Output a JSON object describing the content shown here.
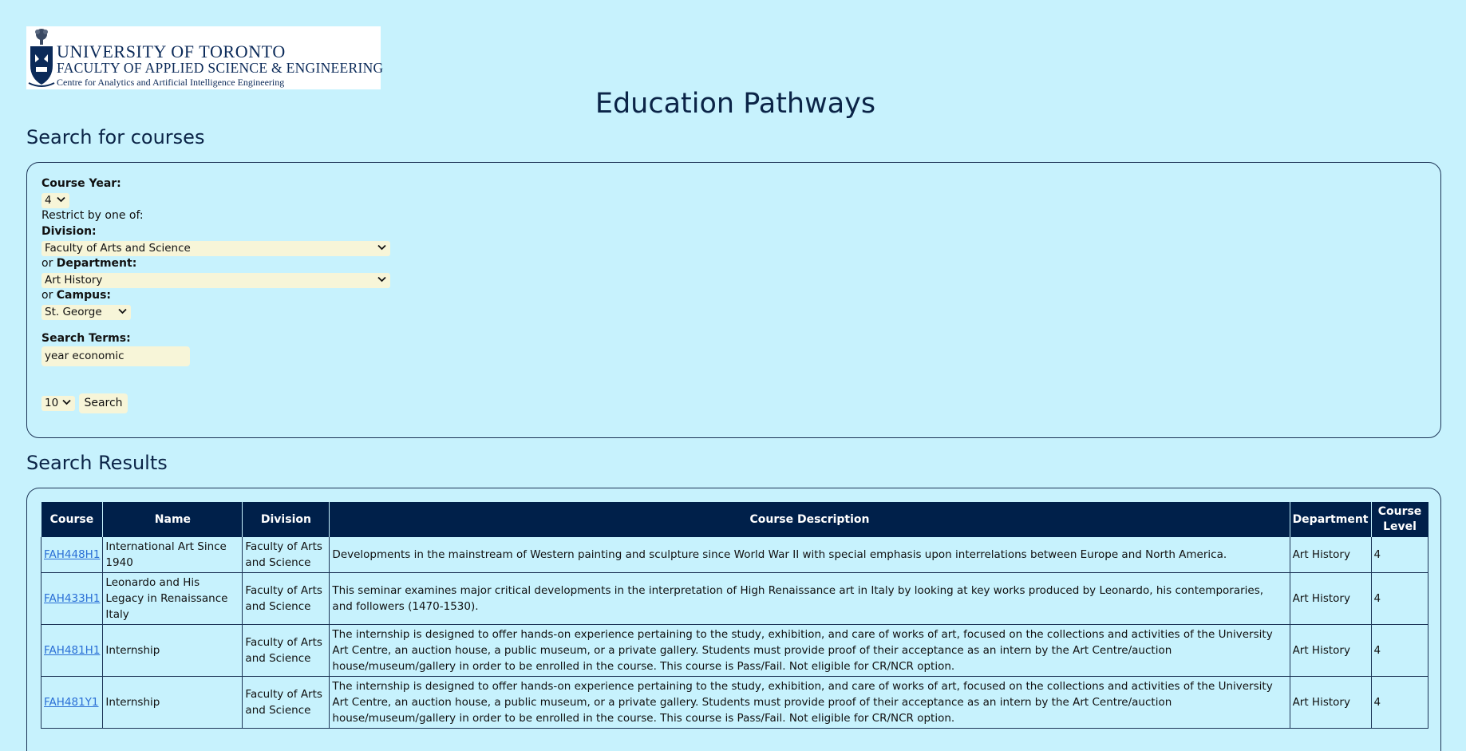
{
  "logo": {
    "line1": "UNIVERSITY OF TORONTO",
    "line2": "FACULTY OF APPLIED SCIENCE & ENGINEERING",
    "line3": "Centre for Analytics and Artificial Intelligence Engineering"
  },
  "app_title": "Education Pathways",
  "search": {
    "heading": "Search for courses",
    "course_year_label": "Course Year:",
    "course_year_value": "4",
    "restrict_text": "Restrict by one of:",
    "division_label": "Division:",
    "division_value": "Faculty of Arts and Science",
    "or_text": "or",
    "department_label": "Department:",
    "department_value": "Art History",
    "campus_label": "Campus:",
    "campus_value": "St. George",
    "terms_label": "Search Terms:",
    "terms_value": "year economic",
    "results_count_value": "10",
    "search_button": "Search"
  },
  "results": {
    "heading": "Search Results",
    "columns": [
      "Course",
      "Name",
      "Division",
      "Course Description",
      "Department",
      "Course Level"
    ],
    "rows": [
      {
        "course": "FAH448H1",
        "name": "International Art Since 1940",
        "division": "Faculty of Arts and Science",
        "description": "Developments in the mainstream of Western painting and sculpture since World War II with special emphasis upon interrelations between Europe and North America.",
        "department": "Art History",
        "level": "4"
      },
      {
        "course": "FAH433H1",
        "name": "Leonardo and His Legacy in Renaissance Italy",
        "division": "Faculty of Arts and Science",
        "description": "This seminar examines major critical developments in the interpretation of High Renaissance art in Italy by looking at key works produced by Leonardo, his contemporaries, and followers (1470-1530).",
        "department": "Art History",
        "level": "4"
      },
      {
        "course": "FAH481H1",
        "name": "Internship",
        "division": "Faculty of Arts and Science",
        "description": "The internship is designed to offer hands-on experience pertaining to the study, exhibition, and care of works of art, focused on the collections and activities of the University Art Centre, an auction house, a public museum, or a private gallery. Students must provide proof of their acceptance as an intern by the Art Centre/auction house/museum/gallery in order to be enrolled in the course. This course is Pass/Fail. Not eligible for CR/NCR option.",
        "department": "Art History",
        "level": "4"
      },
      {
        "course": "FAH481Y1",
        "name": "Internship",
        "division": "Faculty of Arts and Science",
        "description": "The internship is designed to offer hands-on experience pertaining to the study, exhibition, and care of works of art, focused on the collections and activities of the University Art Centre, an auction house, a public museum, or a private gallery. Students must provide proof of their acceptance as an intern by the Art Centre/auction house/museum/gallery in order to be enrolled in the course. This course is Pass/Fail. Not eligible for CR/NCR option.",
        "department": "Art History",
        "level": "4"
      }
    ]
  },
  "colors": {
    "page_bg": "#c7f2fd",
    "header_bg": "#00204a",
    "control_bg": "#f7f5d8",
    "link": "#2a6fd6"
  },
  "icons": [
    "university-crest-icon",
    "chevron-down-icon"
  ]
}
